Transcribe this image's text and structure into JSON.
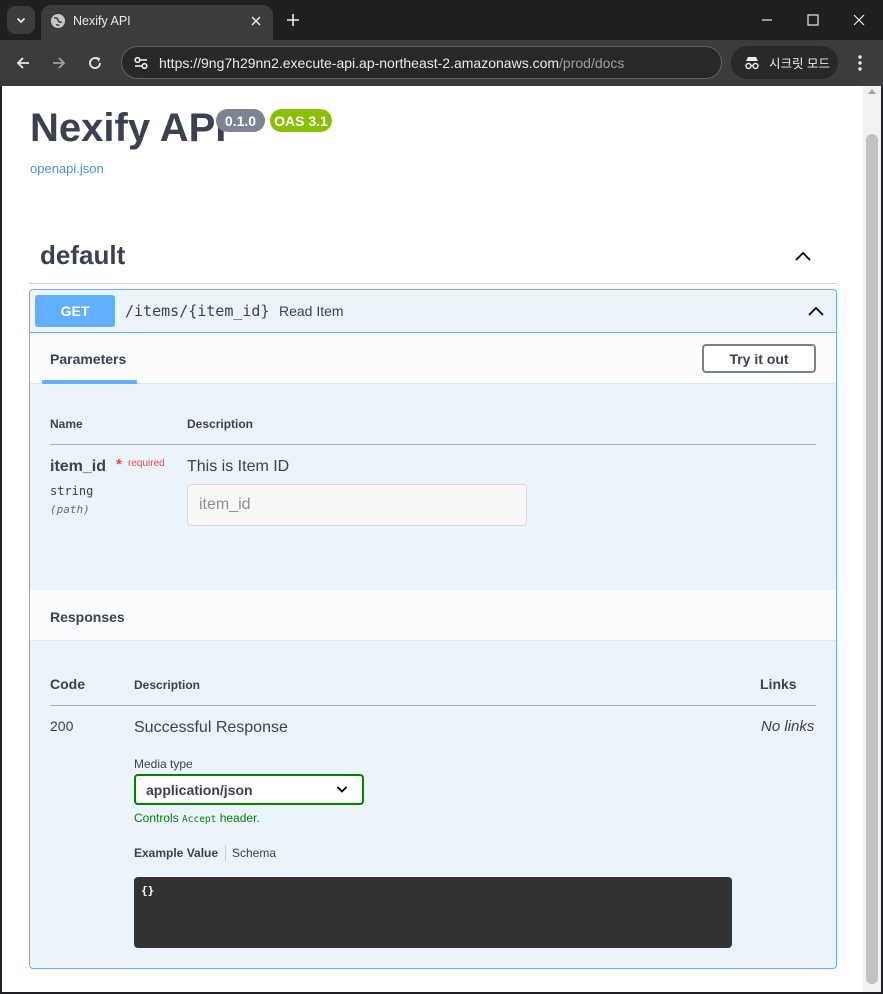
{
  "browser": {
    "tab_title": "Nexify API",
    "url_host": "https://9ng7h29nn2.execute-api.ap-northeast-2.amazonaws.com",
    "url_path": "/prod/docs",
    "incognito_label": "시크릿 모드",
    "icons": [
      "tab-search-icon",
      "globe-icon",
      "close-icon",
      "plus-icon",
      "minimize-icon",
      "maximize-icon",
      "close-window-icon",
      "back-arrow-icon",
      "forward-arrow-icon",
      "reload-icon",
      "site-info-icon",
      "incognito-icon",
      "more-vert-icon"
    ]
  },
  "info": {
    "title": "Nexify API",
    "version": "0.1.0",
    "oas": "OAS 3.1",
    "spec_link": "openapi.json"
  },
  "tag": {
    "name": "default"
  },
  "operation": {
    "method": "GET",
    "path": "/items/{item_id}",
    "summary": "Read Item",
    "parameters_tab": "Parameters",
    "try_button": "Try it out",
    "columns": {
      "name": "Name",
      "description": "Description"
    },
    "parameter": {
      "name": "item_id",
      "required_star": "*",
      "required": "required",
      "type": "string",
      "in": "(path)",
      "description": "This is Item ID",
      "placeholder": "item_id"
    }
  },
  "responses": {
    "title": "Responses",
    "columns": {
      "code": "Code",
      "description": "Description",
      "links": "Links"
    },
    "row": {
      "code": "200",
      "description": "Successful Response",
      "links": "No links",
      "media_type_label": "Media type",
      "media_type": "application/json",
      "controls_prefix": "Controls",
      "controls_code": "Accept",
      "controls_suffix": "header.",
      "tab_example": "Example Value",
      "tab_schema": "Schema",
      "example": "{}"
    }
  },
  "colors": {
    "get_blue": "#61affe",
    "select_green": "#008000",
    "badge_version": "#7d8492",
    "badge_oas": "#89bf04",
    "required_red": "#f93e3e"
  }
}
